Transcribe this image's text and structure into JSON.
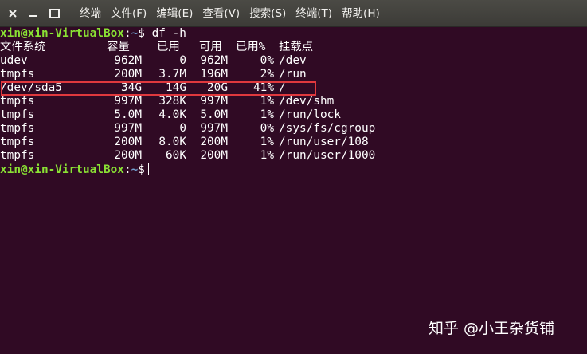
{
  "menubar": {
    "items": [
      "终端",
      "文件(F)",
      "编辑(E)",
      "查看(V)",
      "搜索(S)",
      "终端(T)",
      "帮助(H)"
    ]
  },
  "terminal": {
    "prompt_user": "xin@xin-VirtualBox",
    "prompt_sep": ":",
    "prompt_path": "~",
    "prompt_symbol": "$",
    "command": "df -h",
    "headers": [
      "文件系统",
      "容量",
      "已用",
      "可用",
      "已用%",
      "挂载点"
    ],
    "rows": [
      [
        "udev",
        "962M",
        "0",
        "962M",
        "0%",
        "/dev"
      ],
      [
        "tmpfs",
        "200M",
        "3.7M",
        "196M",
        "2%",
        "/run"
      ],
      [
        "/dev/sda5",
        "34G",
        "14G",
        "20G",
        "41%",
        "/"
      ],
      [
        "tmpfs",
        "997M",
        "328K",
        "997M",
        "1%",
        "/dev/shm"
      ],
      [
        "tmpfs",
        "5.0M",
        "4.0K",
        "5.0M",
        "1%",
        "/run/lock"
      ],
      [
        "tmpfs",
        "997M",
        "0",
        "997M",
        "0%",
        "/sys/fs/cgroup"
      ],
      [
        "tmpfs",
        "200M",
        "8.0K",
        "200M",
        "1%",
        "/run/user/108"
      ],
      [
        "tmpfs",
        "200M",
        "60K",
        "200M",
        "1%",
        "/run/user/1000"
      ]
    ]
  },
  "colors": {
    "background": "#300a24",
    "prompt_user": "#8ae234",
    "prompt_path": "#729fcf",
    "highlight_box": "#e0393e"
  },
  "watermark": "知乎 @小王杂货铺"
}
